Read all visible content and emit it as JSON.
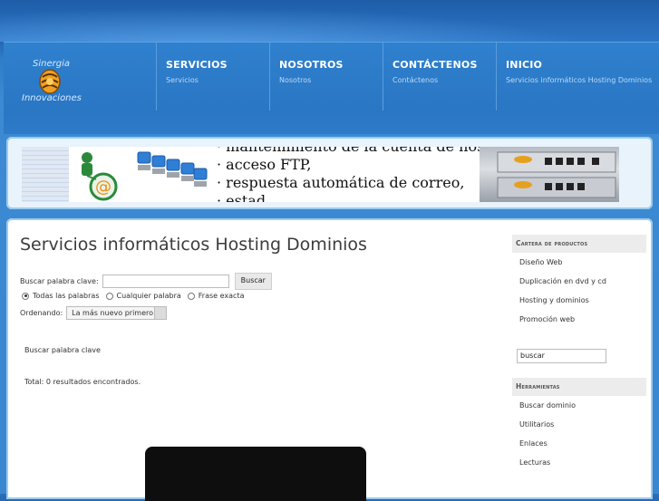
{
  "logo": {
    "line1": "Sinergia",
    "line2": "Innovaciones"
  },
  "nav": [
    {
      "title": "SERVICIOS",
      "sub": "Servicios"
    },
    {
      "title": "NOSOTROS",
      "sub": "Nosotros"
    },
    {
      "title": "CONTÁCTENOS",
      "sub": "Contáctenos"
    },
    {
      "title": "INICIO",
      "sub": "Servicios informáticos Hosting Dominios"
    }
  ],
  "banner": {
    "lines": [
      "· mantenimiento de la cuenta de hosting,",
      "· acceso FTP,",
      "· respuesta automática de correo,",
      "· estad..."
    ]
  },
  "main": {
    "title": "Servicios informáticos Hosting Dominios",
    "search_label": "Buscar palabra clave:",
    "search_value": "",
    "search_button": "Buscar",
    "radio": [
      "Todas las palabras",
      "Cualquier palabra",
      "Frase exacta"
    ],
    "order_label": "Ordenando:",
    "order_value": "La más nuevo primero",
    "msg1": "Buscar palabra clave",
    "msg2": "Total: 0 resultados encontrados."
  },
  "sidebar": {
    "products_head": "Cartera de productos",
    "products": [
      "Diseño Web",
      "Duplicación en dvd y cd",
      "Hosting y dominios",
      "Promoción web"
    ],
    "search_value": "buscar",
    "tools_head": "Herramientas",
    "tools": [
      "Buscar dominio",
      "Utilitarios",
      "Enlaces",
      "Lecturas"
    ]
  },
  "colors": {
    "background": "#3a87d1",
    "nav_title": "#ffffff",
    "nav_sub": "#b9dafa"
  }
}
